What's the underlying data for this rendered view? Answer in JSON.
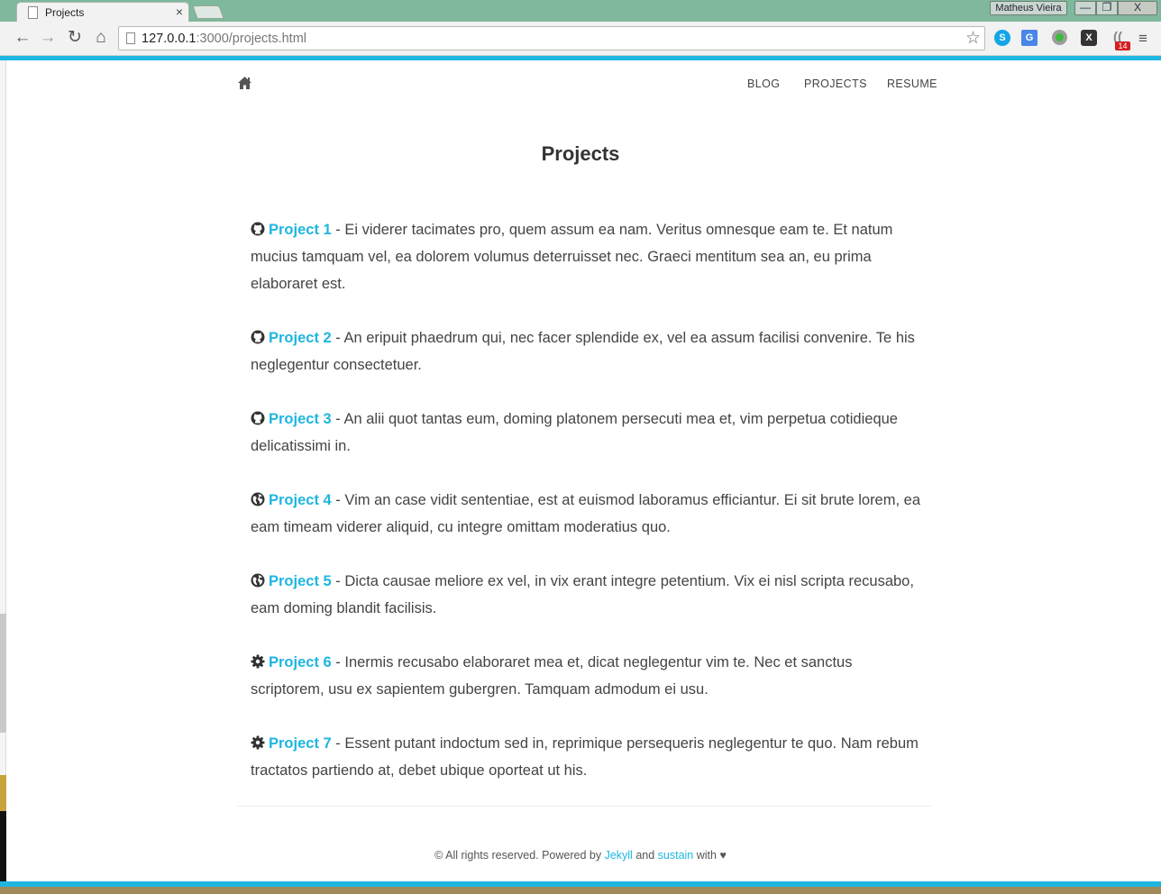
{
  "browser": {
    "tab_title": "Projects",
    "tab_close": "×",
    "user_name": "Matheus Vieira",
    "window_buttons": {
      "minimize": "—",
      "maximize": "❐",
      "close": "X"
    },
    "nav": {
      "back": "←",
      "forward": "→",
      "reload": "↻",
      "home": "⌂"
    },
    "url_host": "127.0.0.1",
    "url_rest": ":3000/projects.html",
    "star": "☆",
    "extensions": {
      "skype": "S",
      "translate": "G",
      "x": "X",
      "rss": "((",
      "badge": "14"
    },
    "menu": "≡",
    "accent_color": "#1fb6e0"
  },
  "header": {
    "home_icon": "home-icon",
    "nav": [
      {
        "label": "BLOG"
      },
      {
        "label": "PROJECTS"
      },
      {
        "label": "RESUME"
      }
    ]
  },
  "page": {
    "title": "Projects"
  },
  "projects": [
    {
      "icon": "github-icon",
      "name": "Project 1",
      "description": " - Ei viderer tacimates pro, quem assum ea nam. Veritus omnesque eam te. Et natum mucius tamquam vel, ea dolorem volumus deterruisset nec. Graeci mentitum sea an, eu prima elaboraret est."
    },
    {
      "icon": "github-icon",
      "name": "Project 2",
      "description": " - An eripuit phaedrum qui, nec facer splendide ex, vel ea assum facilisi convenire. Te his neglegentur consectetuer."
    },
    {
      "icon": "github-icon",
      "name": "Project 3",
      "description": " - An alii quot tantas eum, doming platonem persecuti mea et, vim perpetua cotidieque delicatissimi in."
    },
    {
      "icon": "globe-icon",
      "name": "Project 4",
      "description": " - Vim an case vidit sententiae, est at euismod laboramus efficiantur. Ei sit brute lorem, ea eam timeam viderer aliquid, cu integre omittam moderatius quo."
    },
    {
      "icon": "globe-icon",
      "name": "Project 5",
      "description": " - Dicta causae meliore ex vel, in vix erant integre petentium. Vix ei nisl scripta recusabo, eam doming blandit facilisis."
    },
    {
      "icon": "gear-icon",
      "name": "Project 6",
      "description": " - Inermis recusabo elaboraret mea et, dicat neglegentur vim te. Nec et sanctus scriptorem, usu ex sapientem gubergren. Tamquam admodum ei usu."
    },
    {
      "icon": "gear-icon",
      "name": "Project 7",
      "description": " - Essent putant indoctum sed in, reprimique persequeris neglegentur te quo. Nam rebum tractatos partiendo at, debet ubique oporteat ut his."
    }
  ],
  "footer": {
    "text_before": "© All rights reserved. Powered by ",
    "link1": "Jekyll",
    "text_mid": " and ",
    "link2": "sustain",
    "text_after": " with ♥"
  }
}
